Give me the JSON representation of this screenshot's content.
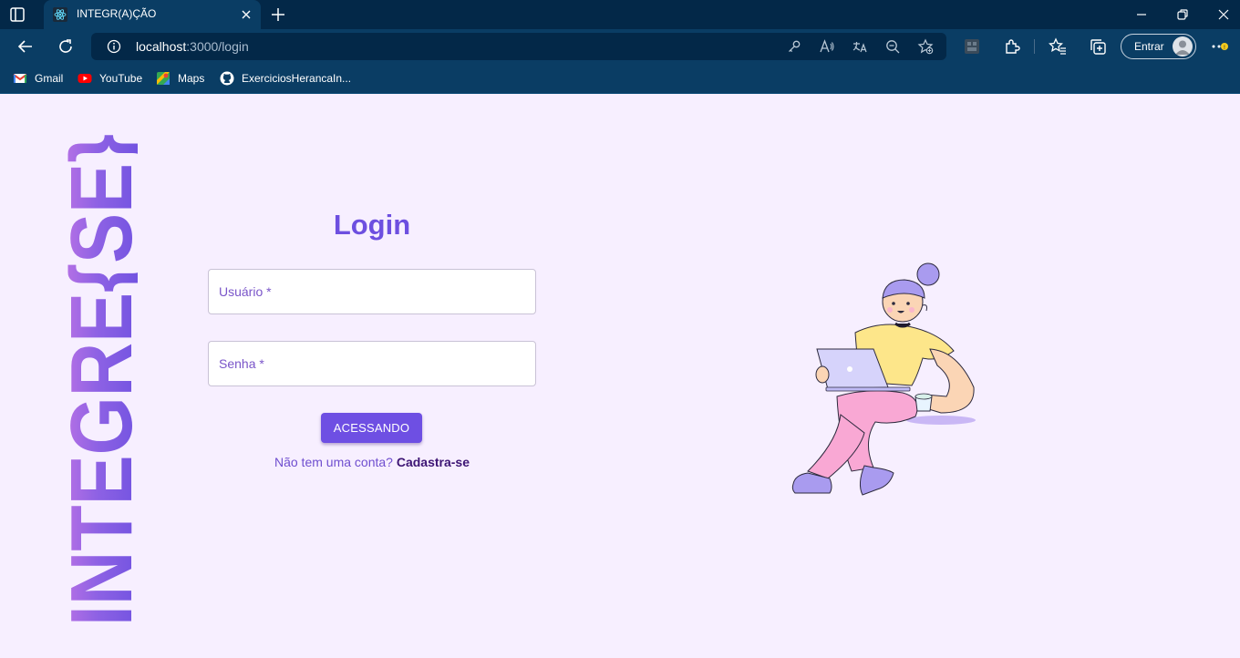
{
  "browser": {
    "tab_title": "INTEGR(A)ÇÃO",
    "url_host": "localhost",
    "url_path": ":3000/login",
    "signin_label": "Entrar",
    "bookmarks": [
      {
        "label": "Gmail",
        "icon": "gmail-icon"
      },
      {
        "label": "YouTube",
        "icon": "youtube-icon"
      },
      {
        "label": "Maps",
        "icon": "maps-icon"
      },
      {
        "label": "ExerciciosHerancaIn...",
        "icon": "github-icon"
      }
    ],
    "colors": {
      "tabbar": "#032848",
      "toolbar": "#0a3d64"
    }
  },
  "page": {
    "brand_text": "INTEGRE{SE}",
    "login": {
      "title": "Login",
      "username_label": "Usuário *",
      "password_label": "Senha *",
      "submit_label": "ACESSANDO",
      "signup_prompt": "Não tem uma conta?",
      "signup_link": "Cadastra-se"
    },
    "colors": {
      "background": "#f7efff",
      "primary": "#6e4fe3",
      "brand_gradient_start": "#6a4fe0",
      "brand_gradient_end": "#c476e6"
    }
  }
}
